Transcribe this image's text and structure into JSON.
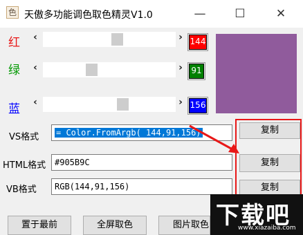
{
  "window": {
    "icon_char": "色",
    "title": "天傲多功能调色取色精灵V1.0",
    "minimize": "—",
    "maximize": "☐",
    "close": "✕"
  },
  "sliders": [
    {
      "label": "红",
      "label_color": "#e81818",
      "value": "144",
      "box_color": "#ff0000",
      "left_arrow": "‹",
      "right_arrow": "›",
      "level": 144
    },
    {
      "label": "绿",
      "label_color": "#009900",
      "value": "91",
      "box_color": "#008000",
      "left_arrow": "‹",
      "right_arrow": "›",
      "level": 91
    },
    {
      "label": "蓝",
      "label_color": "#0000ff",
      "value": "156",
      "box_color": "#0000ff",
      "left_arrow": "‹",
      "right_arrow": "›",
      "level": 156
    }
  ],
  "swatch_color": "#905B9C",
  "formats": {
    "vs": {
      "label": "VS格式",
      "value": " = Color.FromArgb( 144,91,156)",
      "copy": "复制"
    },
    "html": {
      "label": "HTML格式",
      "value": "#905B9C",
      "copy": "复制"
    },
    "vb": {
      "label": "VB格式",
      "value": "RGB(144,91,156)",
      "copy": "复制"
    }
  },
  "bottom_buttons": [
    "置于最前",
    "全屏取色",
    "图片取色"
  ],
  "watermark": {
    "text": "下载吧",
    "url": "www.xiazaiba.com"
  },
  "colors": {
    "highlight_red": "#e81818",
    "selection": "#0078d7"
  }
}
